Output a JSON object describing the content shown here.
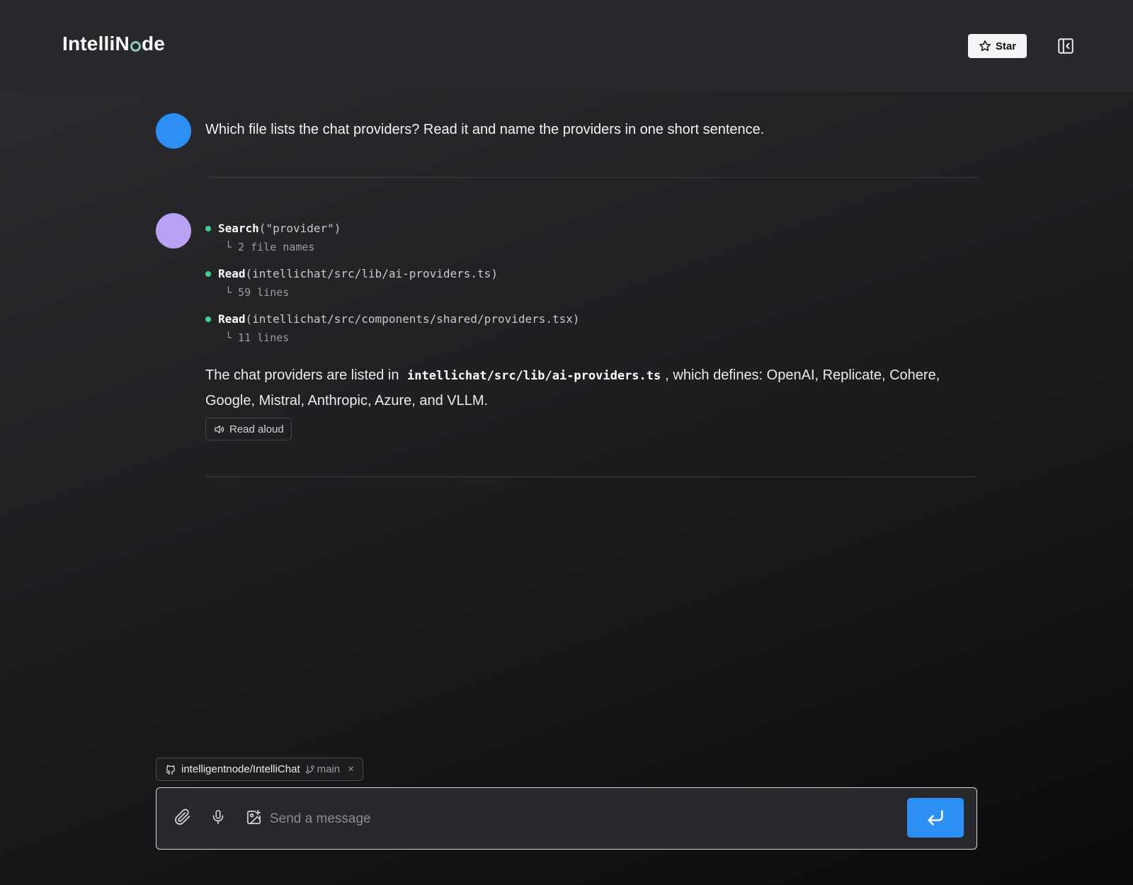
{
  "header": {
    "logo_before": "IntelliN",
    "logo_after": "de",
    "star_label": "Star"
  },
  "messages": {
    "user_text": "Which file lists the chat providers? Read it and name the providers in one short sentence.",
    "tools": [
      {
        "name": "Search",
        "args": "(\"provider\")",
        "result": "└ 2 file names"
      },
      {
        "name": "Read",
        "args": "(intellichat/src/lib/ai-providers.ts)",
        "result": "└ 59 lines"
      },
      {
        "name": "Read",
        "args": "(intellichat/src/components/shared/providers.tsx)",
        "result": "└ 11 lines"
      }
    ],
    "answer_before": "The chat providers are listed in ",
    "answer_code": "intellichat/src/lib/ai-providers.ts",
    "answer_after": ", which defines: OpenAI, Replicate, Cohere, Google, Mistral, Anthropic, Azure, and VLLM.",
    "read_aloud_label": "Read aloud"
  },
  "repo": {
    "name": "intelligentnode/IntelliChat",
    "branch": "main",
    "close": "×"
  },
  "composer": {
    "placeholder": "Send a message"
  },
  "icons": {
    "star": "star-icon",
    "panel": "panel-collapse-icon",
    "speaker": "speaker-icon",
    "github": "github-icon",
    "branch": "git-branch-icon",
    "paperclip": "paperclip-icon",
    "mic": "microphone-icon",
    "image": "image-add-icon",
    "enter": "enter-icon"
  },
  "colors": {
    "accent": "#2b8ff4",
    "ai_avatar": "#b9a2f4",
    "tool_dot": "#3fcf8e"
  }
}
